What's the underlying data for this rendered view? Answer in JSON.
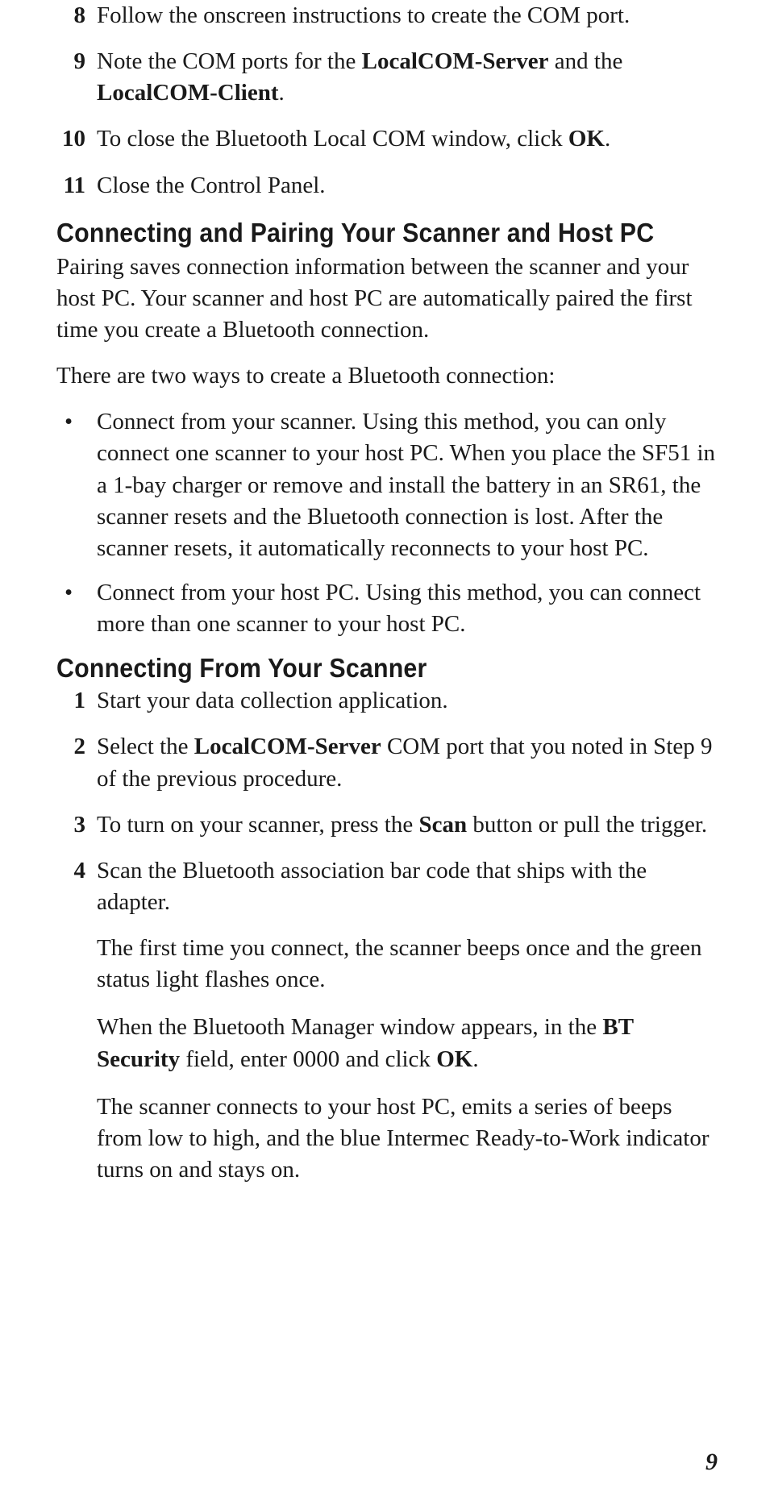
{
  "steps_a": [
    {
      "n": "8",
      "pre": "Follow the onscreen instructions to create the COM port.",
      "bold": "",
      "post": ""
    },
    {
      "n": "9",
      "pre": "Note the COM ports for the ",
      "bold": "LocalCOM-Server",
      "mid": " and the ",
      "bold2": "LocalCOM-Client",
      "post": "."
    },
    {
      "n": "10",
      "pre": "To close the Bluetooth Local COM window, click ",
      "bold": "OK",
      "post": "."
    },
    {
      "n": "11",
      "pre": "Close the Control Panel.",
      "bold": "",
      "post": ""
    }
  ],
  "h2_1": "Connecting and Pairing Your Scanner and Host PC",
  "para1": "Pairing saves connection information between the scanner and your host PC. Your scanner and host PC are automatically paired the first time you create a Bluetooth connection.",
  "para2": "There are two ways to create a Bluetooth connection:",
  "bullets": [
    "Connect from your scanner. Using this method, you can only connect one scanner to your host PC. When you place the SF51 in a 1-bay charger or remove and install the battery in an SR61, the scanner resets and the Bluetooth connection is lost. After the scanner resets, it automatically reconnects to your host PC.",
    "Connect from your host PC. Using this method, you can connect more than one scanner to your host PC."
  ],
  "h3_1": "Connecting From Your Scanner",
  "steps_b": [
    {
      "n": "1",
      "pre": "Start your data collection application.",
      "bold": "",
      "post": ""
    },
    {
      "n": "2",
      "pre": "Select the ",
      "bold": "LocalCOM-Server",
      "post": " COM port that you noted in Step 9 of the previous procedure."
    },
    {
      "n": "3",
      "pre": "To turn on your scanner, press the ",
      "bold": "Scan",
      "post": " button or pull the trigger."
    },
    {
      "n": "4",
      "pre": "Scan the Bluetooth association bar code that ships with the adapter.",
      "bold": "",
      "post": ""
    }
  ],
  "sub1": "The first time you connect, the scanner beeps once and the green status light flashes once.",
  "sub2_pre": "When the Bluetooth Manager window appears, in the ",
  "sub2_b1": "BT Security",
  "sub2_mid": " field, enter 0000 and click ",
  "sub2_b2": "OK",
  "sub2_post": ".",
  "sub3": "The scanner connects to your host PC, emits a series of beeps from low to high, and the blue Intermec Ready-to-Work indicator turns on and stays on.",
  "page": "9"
}
